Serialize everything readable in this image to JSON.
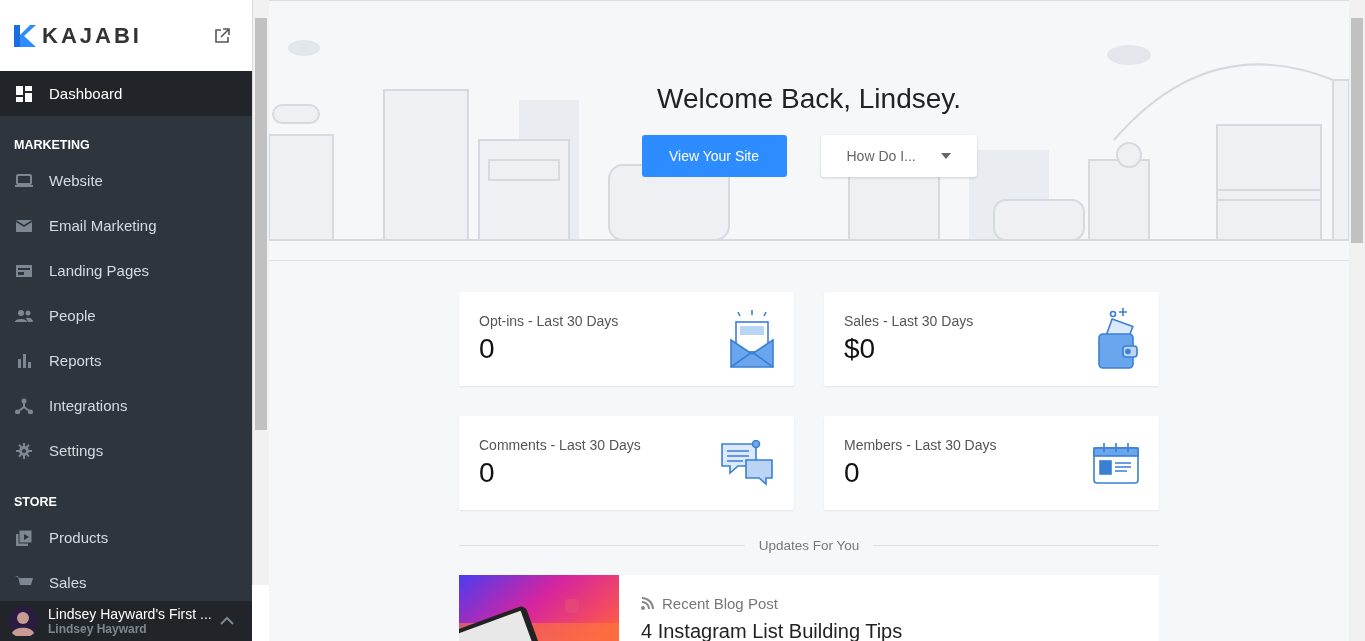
{
  "sidebar": {
    "logo": "KAJABI",
    "nav": [
      {
        "kind": "item",
        "label": "Dashboard",
        "selected": true
      },
      {
        "kind": "heading",
        "label": "MARKETING"
      },
      {
        "kind": "item",
        "label": "Website",
        "selected": false
      },
      {
        "kind": "item",
        "label": "Email Marketing",
        "selected": false
      },
      {
        "kind": "item",
        "label": "Landing Pages",
        "selected": false
      },
      {
        "kind": "item",
        "label": "People",
        "selected": false
      },
      {
        "kind": "item",
        "label": "Reports",
        "selected": false
      },
      {
        "kind": "item",
        "label": "Integrations",
        "selected": false
      },
      {
        "kind": "item",
        "label": "Settings",
        "selected": false
      },
      {
        "kind": "heading",
        "label": "STORE"
      },
      {
        "kind": "item",
        "label": "Products",
        "selected": false
      },
      {
        "kind": "item",
        "label": "Sales",
        "selected": false
      }
    ],
    "footer": {
      "site": "Lindsey Hayward's First ...",
      "user": "Lindsey Hayward"
    }
  },
  "hero": {
    "title": "Welcome Back, Lindsey.",
    "primary_button": "View Your Site",
    "dropdown": "How Do I..."
  },
  "stats": [
    {
      "label": "Opt-ins - Last 30 Days",
      "value": "0"
    },
    {
      "label": "Sales - Last 30 Days",
      "value": "$0"
    },
    {
      "label": "Comments - Last 30 Days",
      "value": "0"
    },
    {
      "label": "Members - Last 30 Days",
      "value": "0"
    }
  ],
  "updates": {
    "heading": "Updates For You",
    "post": {
      "category": "Recent Blog Post",
      "title": "4 Instagram List Building Tips"
    }
  }
}
